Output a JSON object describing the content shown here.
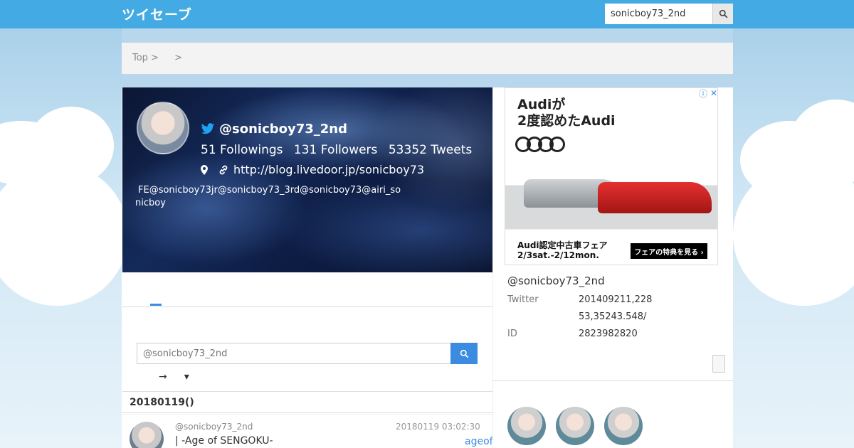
{
  "app": {
    "logo": "ツイセーブ"
  },
  "header_search": {
    "value": "sonicboy73_2nd"
  },
  "breadcrumb": {
    "items": [
      "Top >",
      ">"
    ]
  },
  "profile": {
    "handle": "@sonicboy73_2nd",
    "followings": "51 Followings",
    "followers": "131 Followers",
    "tweets": "53352 Tweets",
    "link": "http://blog.livedoor.jp/sonicboy73",
    "bio_line1": "FE@sonicboy73jr@sonicboy73_3rd@sonicboy73@airi_so",
    "bio_line2": "nicboy"
  },
  "tweet_search": {
    "placeholder": "@sonicboy73_2nd"
  },
  "sort": {
    "arrow": "→",
    "caret": "▾"
  },
  "timeline": {
    "date_header": "20180119()",
    "tweets": [
      {
        "user": "@sonicboy73_2nd",
        "time": "20180119 03:02:30",
        "text": "|  -Age of SENGOKU-",
        "tag": "ageof"
      }
    ]
  },
  "ad": {
    "headline1": "Audiが",
    "headline2": "2度認めたAudi",
    "footer1": "Audi認定中古車フェア",
    "footer2": "2/3sat.-2/12mon.",
    "cta": "フェアの特典を見る ›",
    "info_icon": "ⓘ",
    "close_icon": "✕"
  },
  "user_info": {
    "handle": "@sonicboy73_2nd",
    "rows": [
      {
        "label": "Twitter",
        "value": "201409211,228"
      },
      {
        "label": "",
        "value": "53,35243.548/"
      },
      {
        "label": "ID",
        "value": "2823982820"
      }
    ]
  },
  "colors": {
    "header": "#44aae3",
    "accent": "#3b8be0"
  },
  "icons": {
    "search": "search-icon",
    "twitter": "twitter-bird-icon",
    "location": "map-marker-icon",
    "link": "link-icon"
  }
}
